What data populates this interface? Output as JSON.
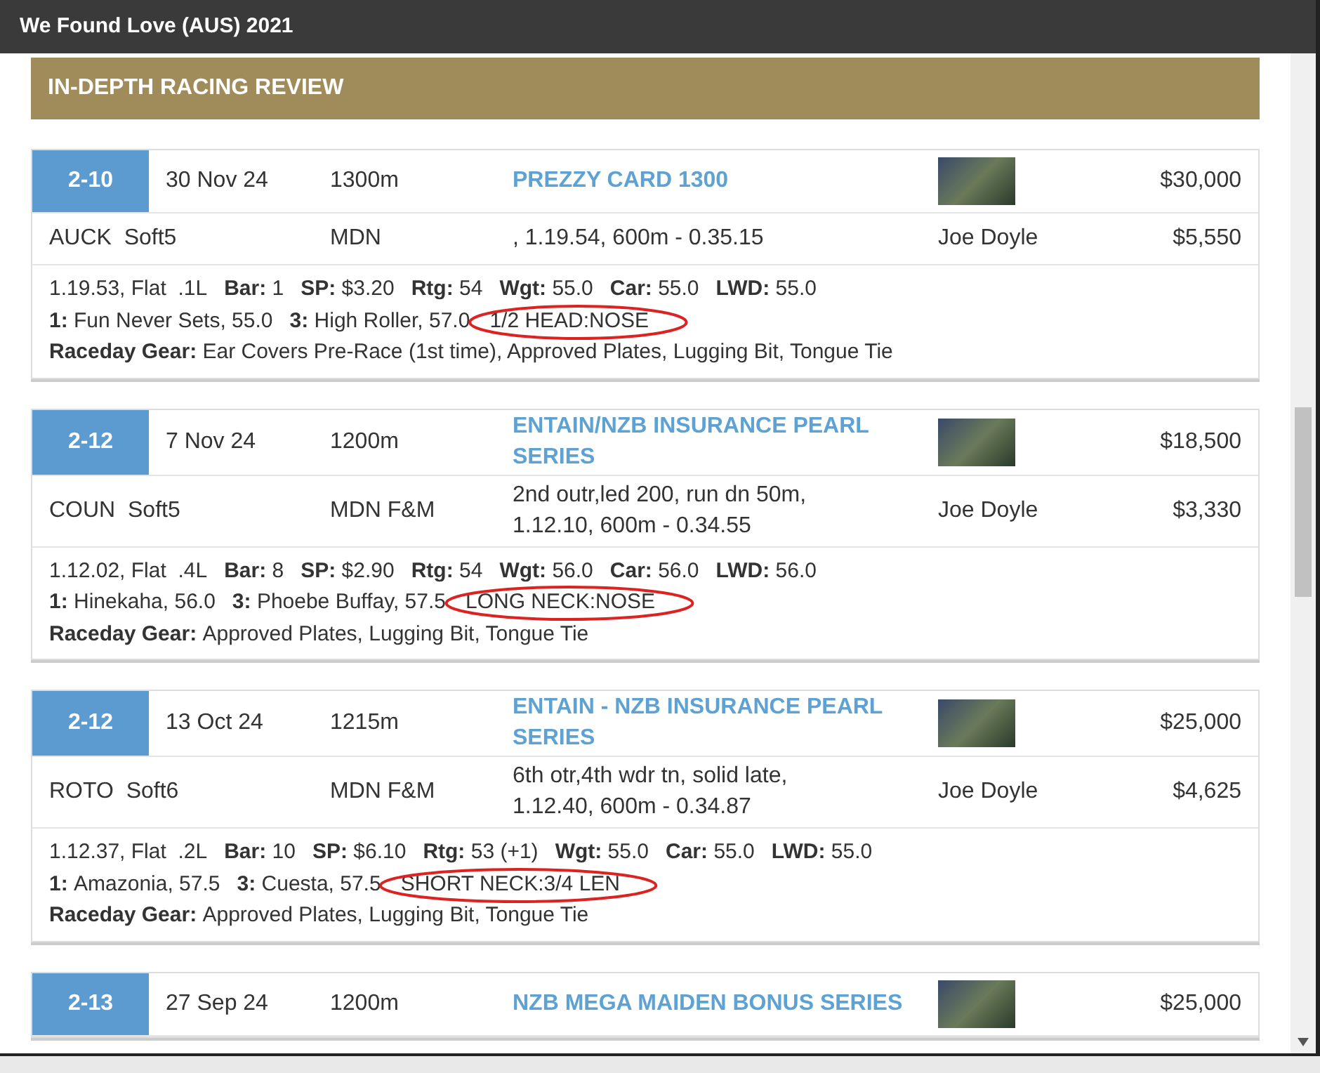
{
  "window": {
    "title": "We Found Love (AUS) 2021"
  },
  "section": {
    "title": "IN-DEPTH RACING REVIEW"
  },
  "races": [
    {
      "placing": "2-10",
      "date": "30 Nov 24",
      "distance": "1300m",
      "race_name": [
        "PREZZY CARD 1300"
      ],
      "prize": "$30,000",
      "track": "AUCK  Soft5",
      "class": "MDN",
      "comment": [
        ", 1.19.54, 600m - 0.35.15"
      ],
      "jockey": "Joe Doyle",
      "stake": "$5,550",
      "stats": [
        {
          "value": "1.19.53, Flat  .1L"
        },
        {
          "label": "Bar:",
          "value": "1"
        },
        {
          "label": "SP:",
          "value": "$3.20"
        },
        {
          "label": "Rtg:",
          "value": "54"
        },
        {
          "label": "Wgt:",
          "value": "55.0"
        },
        {
          "label": "Car:",
          "value": "55.0"
        },
        {
          "label": "LWD:",
          "value": "55.0"
        }
      ],
      "placings": [
        {
          "label": "1:",
          "value": "Fun Never Sets, 55.0"
        },
        {
          "label": "3:",
          "value": "High Roller, 57.0"
        }
      ],
      "margin": {
        "text": "1/2 HEAD:NOSE",
        "circled": true
      },
      "gear": {
        "label": "Raceday Gear:",
        "value": "Ear Covers Pre-Race (1st time), Approved Plates, Lugging Bit, Tongue Tie"
      }
    },
    {
      "placing": "2-12",
      "date": "7 Nov 24",
      "distance": "1200m",
      "race_name": [
        "ENTAIN/NZB INSURANCE PEARL",
        "SERIES"
      ],
      "prize": "$18,500",
      "track": "COUN  Soft5",
      "class": "MDN F&M",
      "comment": [
        "2nd outr,led 200, run dn 50m,",
        "1.12.10, 600m - 0.34.55"
      ],
      "jockey": "Joe Doyle",
      "stake": "$3,330",
      "stats": [
        {
          "value": "1.12.02, Flat  .4L"
        },
        {
          "label": "Bar:",
          "value": "8"
        },
        {
          "label": "SP:",
          "value": "$2.90"
        },
        {
          "label": "Rtg:",
          "value": "54"
        },
        {
          "label": "Wgt:",
          "value": "56.0"
        },
        {
          "label": "Car:",
          "value": "56.0"
        },
        {
          "label": "LWD:",
          "value": "56.0"
        }
      ],
      "placings": [
        {
          "label": "1:",
          "value": "Hinekaha, 56.0"
        },
        {
          "label": "3:",
          "value": "Phoebe Buffay, 57.5"
        }
      ],
      "margin": {
        "text": "LONG NECK:NOSE",
        "circled": true
      },
      "gear": {
        "label": "Raceday Gear:",
        "value": "Approved Plates, Lugging Bit, Tongue Tie"
      }
    },
    {
      "placing": "2-12",
      "date": "13 Oct 24",
      "distance": "1215m",
      "race_name": [
        "ENTAIN - NZB INSURANCE PEARL",
        "SERIES"
      ],
      "prize": "$25,000",
      "track": "ROTO  Soft6",
      "class": "MDN F&M",
      "comment": [
        "6th otr,4th wdr tn, solid late,",
        "1.12.40, 600m - 0.34.87"
      ],
      "jockey": "Joe Doyle",
      "stake": "$4,625",
      "stats": [
        {
          "value": "1.12.37, Flat  .2L"
        },
        {
          "label": "Bar:",
          "value": "10"
        },
        {
          "label": "SP:",
          "value": "$6.10"
        },
        {
          "label": "Rtg:",
          "value": "53 (+1)"
        },
        {
          "label": "Wgt:",
          "value": "55.0"
        },
        {
          "label": "Car:",
          "value": "55.0"
        },
        {
          "label": "LWD:",
          "value": "55.0"
        }
      ],
      "placings": [
        {
          "label": "1:",
          "value": "Amazonia, 57.5"
        },
        {
          "label": "3:",
          "value": "Cuesta, 57.5"
        }
      ],
      "margin": {
        "text": "SHORT NECK:3/4 LEN",
        "circled": true
      },
      "gear": {
        "label": "Raceday Gear:",
        "value": "Approved Plates, Lugging Bit, Tongue Tie"
      }
    },
    {
      "placing": "2-13",
      "date": "27 Sep 24",
      "distance": "1200m",
      "race_name": [
        "NZB MEGA MAIDEN BONUS SERIES"
      ],
      "prize": "$25,000"
    }
  ]
}
